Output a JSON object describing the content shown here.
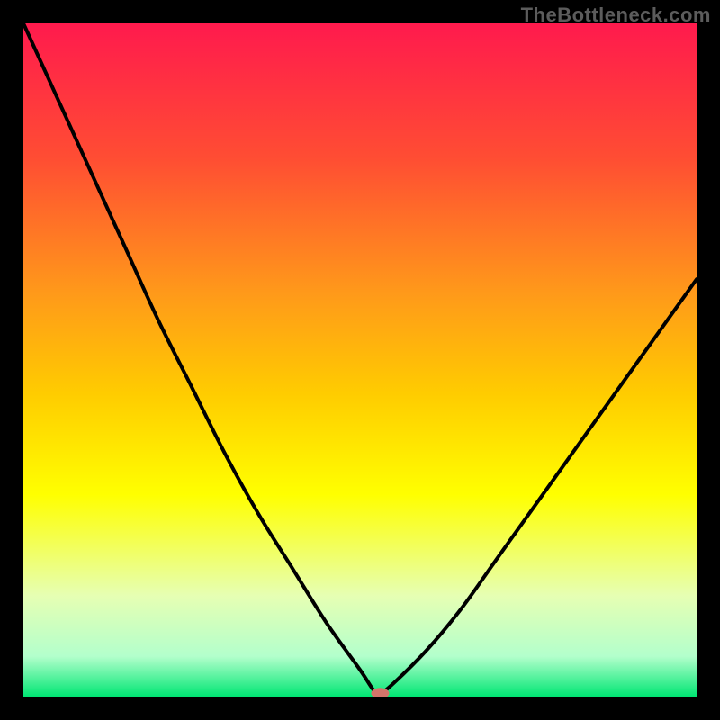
{
  "attribution": "TheBottleneck.com",
  "chart_data": {
    "type": "line",
    "title": "",
    "xlabel": "",
    "ylabel": "",
    "xlim": [
      0,
      100
    ],
    "ylim": [
      0,
      100
    ],
    "grid": false,
    "curve_description": "V-shaped bottleneck curve: steep descent from top-left, flat minimum near x≈53, rising toward upper-right",
    "x": [
      0,
      5,
      10,
      15,
      20,
      25,
      30,
      35,
      40,
      45,
      50,
      52,
      53,
      55,
      60,
      65,
      70,
      75,
      80,
      85,
      90,
      95,
      100
    ],
    "y": [
      100,
      89,
      78,
      67,
      56,
      46,
      36,
      27,
      19,
      11,
      4,
      1,
      0.5,
      2,
      7,
      13,
      20,
      27,
      34,
      41,
      48,
      55,
      62
    ],
    "minimum_marker": {
      "x": 53,
      "y": 0.5,
      "color": "#d4756b"
    },
    "background_gradient_stops": [
      {
        "pct": 0,
        "color": "#ff1a4d"
      },
      {
        "pct": 20,
        "color": "#ff4d33"
      },
      {
        "pct": 40,
        "color": "#ff991a"
      },
      {
        "pct": 55,
        "color": "#ffcc00"
      },
      {
        "pct": 70,
        "color": "#ffff00"
      },
      {
        "pct": 85,
        "color": "#e6ffb3"
      },
      {
        "pct": 94,
        "color": "#b3ffcc"
      },
      {
        "pct": 100,
        "color": "#00e673"
      }
    ]
  }
}
